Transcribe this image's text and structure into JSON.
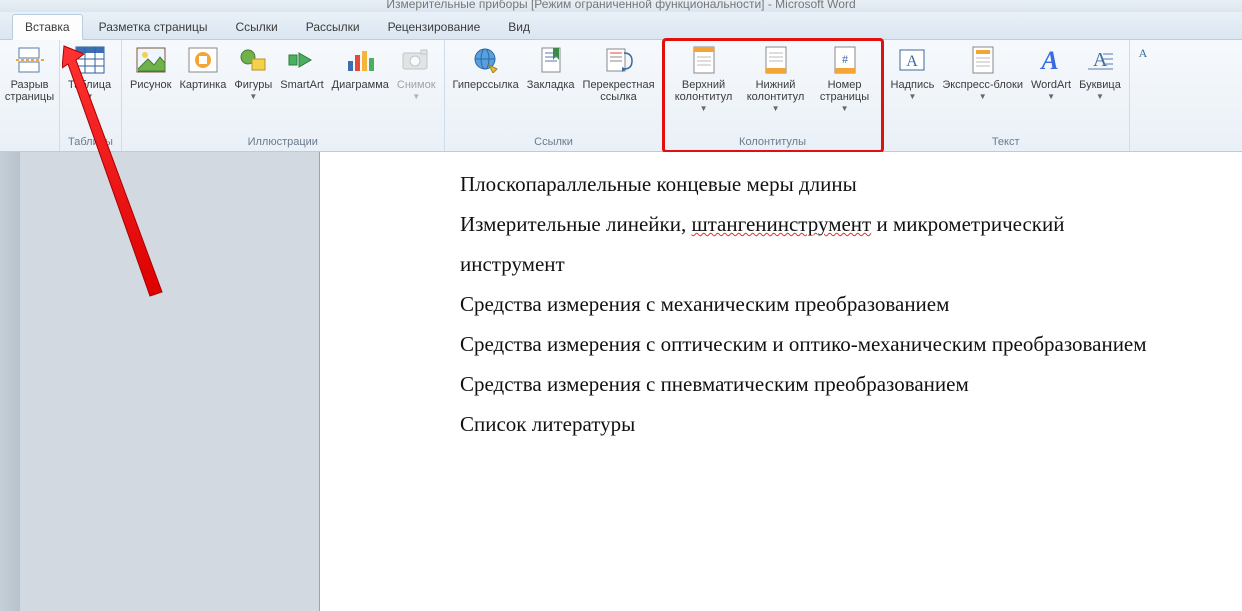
{
  "title": "Измерительные приборы [Режим ограниченной функциональности] - Microsoft Word",
  "tabs": {
    "t0": "Вставка",
    "t1": "Разметка страницы",
    "t2": "Ссылки",
    "t3": "Рассылки",
    "t4": "Рецензирование",
    "t5": "Вид"
  },
  "ribbon": {
    "pages": {
      "break": "Разрыв\nстраницы",
      "label": ""
    },
    "tables": {
      "table": "Таблица",
      "label": "Таблицы"
    },
    "illus": {
      "picture": "Рисунок",
      "clipart": "Картинка",
      "shapes": "Фигуры",
      "smartart": "SmartArt",
      "chart": "Диаграмма",
      "screenshot": "Снимок",
      "label": "Иллюстрации"
    },
    "links": {
      "hyperlink": "Гиперссылка",
      "bookmark": "Закладка",
      "crossref": "Перекрестная\nссылка",
      "label": "Ссылки"
    },
    "hf": {
      "header": "Верхний\nколонтитул",
      "footer": "Нижний\nколонтитул",
      "pagenum": "Номер\nстраницы",
      "label": "Колонтитулы"
    },
    "text": {
      "textbox": "Надпись",
      "quickparts": "Экспресс-блоки",
      "wordart": "WordArt",
      "dropcap": "Буквица",
      "label": "Текст"
    }
  },
  "doc": {
    "l1a": "Плоскопараллельные концевые меры длины",
    "l2a": "Измерительные линейки, ",
    "l2b": "штангенинструмент",
    "l2c": " и микрометрический",
    "l3": "инструмент",
    "l4": "Средства измерения с механическим преобразованием",
    "l5": "Средства измерения с оптическим и оптико-механическим преобразованием",
    "l6": "Средства измерения с пневматическим преобразованием",
    "l7": "Список литературы"
  }
}
